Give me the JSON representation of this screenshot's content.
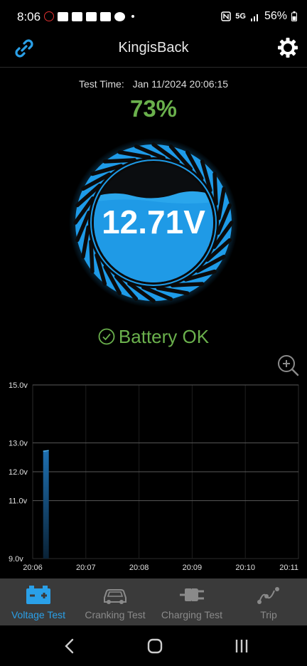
{
  "status_bar": {
    "time": "8:06",
    "network": "5G",
    "battery": "56%",
    "icons": [
      "vpn-icon",
      "youtube-icon",
      "mail-icon",
      "mail-icon",
      "gallery-icon",
      "navigation-icon"
    ]
  },
  "app_bar": {
    "title": "KingisBack",
    "left_icon": "link-icon",
    "right_icon": "gear-icon"
  },
  "test": {
    "time_label": "Test Time:",
    "time_value": "Jan 11/2024 20:06:15",
    "percent": "73%",
    "voltage": "12.71V",
    "status": "Battery OK"
  },
  "colors": {
    "accent": "#2aa0e8",
    "ok_green": "#6ab04c",
    "gauge_blue": "#1e9be8",
    "nav_bg": "#3a3a3a"
  },
  "chart_data": {
    "type": "bar",
    "y_tick_labels": [
      "15.0v",
      "13.0v",
      "12.0v",
      "11.0v",
      "9.0v"
    ],
    "x_tick_labels": [
      "20:06",
      "20:07",
      "20:08",
      "20:09",
      "20:10",
      "20:11"
    ],
    "y_tick_values": [
      15.0,
      13.0,
      12.0,
      11.0,
      9.0
    ],
    "ylim": [
      9.0,
      15.0
    ],
    "xlim": [
      "20:06",
      "20:11"
    ],
    "x": [
      "20:06:15"
    ],
    "values": [
      12.71
    ],
    "grid": true
  },
  "nav": {
    "items": [
      {
        "label": "Voltage Test",
        "icon": "battery-icon",
        "active": true
      },
      {
        "label": "Cranking Test",
        "icon": "car-icon",
        "active": false
      },
      {
        "label": "Charging Test",
        "icon": "plug-icon",
        "active": false
      },
      {
        "label": "Trip",
        "icon": "trip-icon",
        "active": false
      }
    ]
  }
}
